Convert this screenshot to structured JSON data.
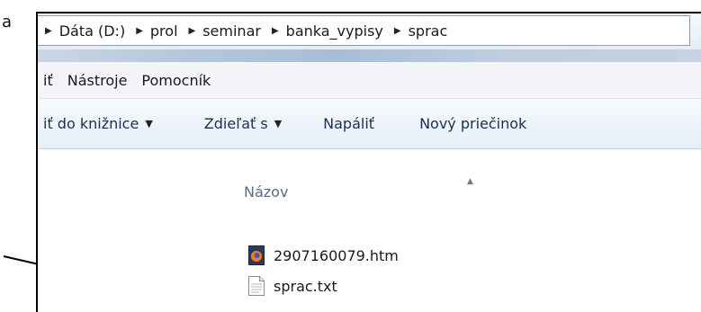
{
  "doc_fragment": "a",
  "breadcrumb": [
    "Dáta (D:)",
    "prol",
    "seminar",
    "banka_vypisy",
    "sprac"
  ],
  "menubar": {
    "items": [
      "iť",
      "Nástroje",
      "Pomocník"
    ]
  },
  "toolbar": {
    "include_library": "iť do knižnice",
    "share_with": "Zdieľať s",
    "burn": "Napáliť",
    "new_folder": "Nový priečinok"
  },
  "columns": {
    "name": "Názov"
  },
  "files": [
    {
      "name": "2907160079.htm",
      "icon": "firefox-html-file-icon"
    },
    {
      "name": "sprac.txt",
      "icon": "text-file-icon"
    }
  ]
}
